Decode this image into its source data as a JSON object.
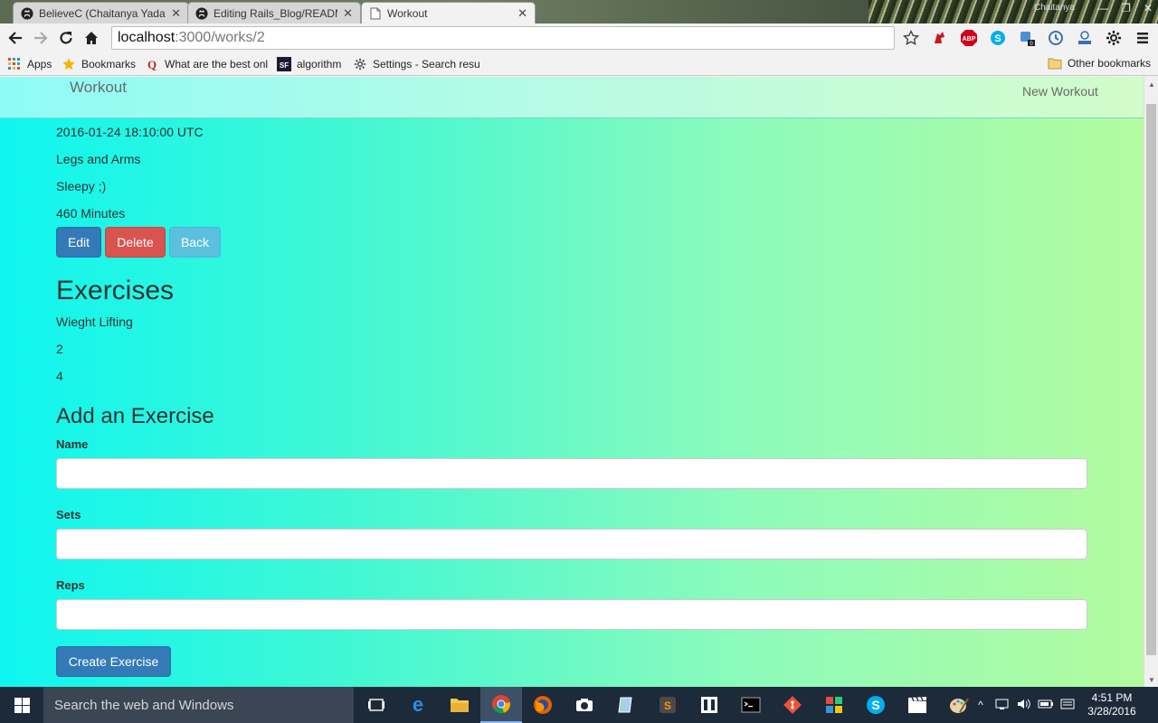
{
  "browser": {
    "tabs": [
      {
        "title": "BelieveC (Chaitanya Yadav"
      },
      {
        "title": "Editing Rails_Blog/READM"
      },
      {
        "title": "Workout",
        "active": true
      }
    ],
    "window_user": "Chaitanya",
    "url_host": "localhost",
    "url_path": ":3000/works/2",
    "bookmarks": [
      {
        "label": "Apps",
        "icon": "apps-grid-icon"
      },
      {
        "label": "Bookmarks",
        "icon": "star-icon"
      },
      {
        "label": "What are the best onl",
        "icon": "quora-icon"
      },
      {
        "label": "algorithm",
        "icon": "sf-icon"
      },
      {
        "label": "Settings - Search resu",
        "icon": "gear-icon"
      }
    ],
    "other_bookmarks": "Other bookmarks",
    "extensions": [
      "star-icon",
      "lastpass-icon",
      "adblock-icon",
      "skype-icon",
      "extension-icon",
      "history-icon",
      "download-icon",
      "gear-icon",
      "menu-icon"
    ],
    "ext_badge": "0"
  },
  "app": {
    "brand": "Workout",
    "new_link": "New Workout"
  },
  "workout": {
    "date": "2016-01-24 18:10:00 UTC",
    "name": "Legs and Arms",
    "mood": "Sleepy ;)",
    "length": "460 Minutes"
  },
  "actions": {
    "edit": "Edit",
    "delete": "Delete",
    "back": "Back"
  },
  "exercises": {
    "heading": "Exercises",
    "items": [
      {
        "name": "Wieght Lifting",
        "sets": "2",
        "reps": "4"
      }
    ]
  },
  "form": {
    "heading": "Add an Exercise",
    "name_label": "Name",
    "sets_label": "Sets",
    "reps_label": "Reps",
    "submit": "Create Exercise"
  },
  "taskbar": {
    "search_placeholder": "Search the web and Windows",
    "time": "4:51 PM",
    "date": "3/28/2016",
    "apps": [
      "task-view-icon",
      "edge-icon",
      "file-explorer-icon",
      "chrome-icon",
      "firefox-icon",
      "camera-icon",
      "notes-icon",
      "sublime-icon",
      "app-icon",
      "terminal-icon",
      "git-icon",
      "office-icon",
      "skype-icon",
      "movies-icon",
      "paint-icon"
    ]
  }
}
